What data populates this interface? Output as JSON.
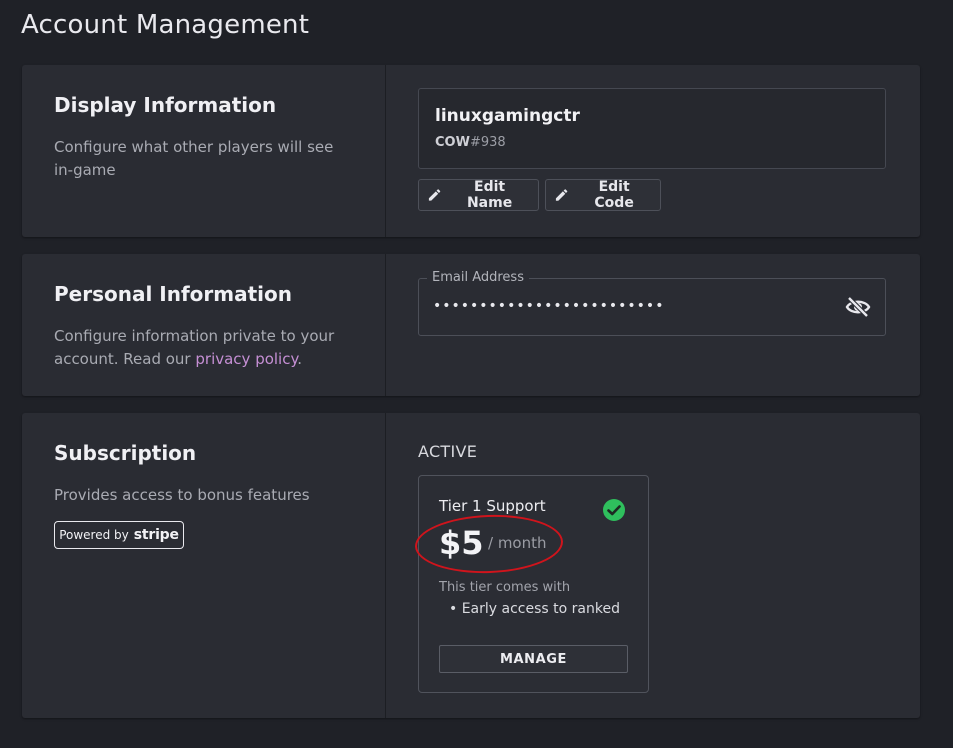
{
  "page": {
    "title": "Account Management"
  },
  "display_info": {
    "title": "Display Information",
    "description": "Configure what other players will see in-game",
    "name": "linuxgamingctr",
    "code_prefix": "COW",
    "code_suffix": "#938",
    "edit_name_label": "Edit Name",
    "edit_code_label": "Edit Code"
  },
  "personal_info": {
    "title": "Personal Information",
    "description_before": "Configure information private to your account. Read our ",
    "privacy_link": "privacy policy",
    "description_after": ".",
    "email_label": "Email Address",
    "email_value": "•••••••••••••••••••••••••",
    "visibility_icon": "eye-off-icon"
  },
  "subscription": {
    "title": "Subscription",
    "description": "Provides access to bonus features",
    "powered_by": "Powered by",
    "provider": "stripe",
    "status": "ACTIVE",
    "tier": {
      "name": "Tier 1 Support",
      "price": "$5",
      "period": "/ month",
      "description": "This tier comes with",
      "feature": "• Early access to ranked",
      "manage_label": "MANAGE",
      "status_icon": "check-circle-icon"
    }
  },
  "colors": {
    "background": "#1f2127",
    "card": "#2a2c33",
    "link": "#c58fd4",
    "check": "#2fbf5d",
    "annotation": "#d0141c"
  }
}
